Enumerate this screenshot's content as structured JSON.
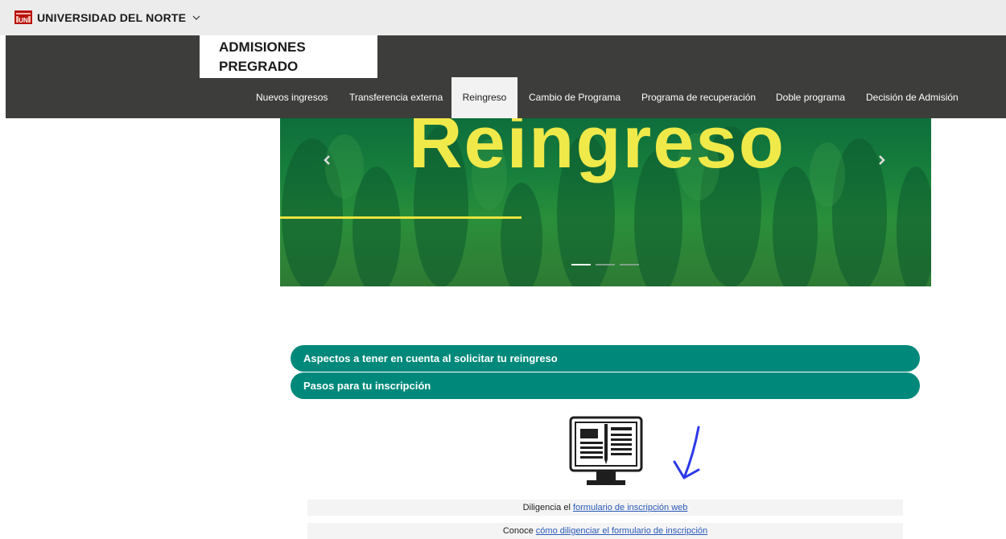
{
  "header": {
    "university": "UNIVERSIDAD DEL NORTE",
    "logo_text": "UN",
    "section_title_line1": "ADMISIONES",
    "section_title_line2": "PREGRADO"
  },
  "nav": {
    "items": [
      {
        "label": "Nuevos ingresos"
      },
      {
        "label": "Transferencia externa"
      },
      {
        "label": "Reingreso"
      },
      {
        "label": "Cambio de Programa"
      },
      {
        "label": "Programa de recuperación"
      },
      {
        "label": "Doble programa"
      },
      {
        "label": "Decisión de Admisión"
      }
    ],
    "active_index": 2
  },
  "hero": {
    "title": "Reingreso",
    "slides_count": 3,
    "active_slide": 0,
    "prev_icon": "chevron-left-icon",
    "next_icon": "chevron-right-icon"
  },
  "accordion": {
    "items": [
      {
        "label": "Aspectos a tener en cuenta al solicitar tu reingreso"
      },
      {
        "label": "Pasos para tu inscripción"
      }
    ]
  },
  "steps": {
    "row1": {
      "prefix": "Diligencia el ",
      "link": "formulario de inscripción web"
    },
    "row2": {
      "prefix": "Conoce ",
      "link": "cómo diligenciar el formulario de inscripción"
    }
  },
  "icons": {
    "monitor": "monitor-form-icon",
    "annotation": "blue-arrow-annotation"
  },
  "colors": {
    "nav_bg": "#3d3d3c",
    "accordion_bg": "#00897b",
    "hero_text": "#f0e94a",
    "link": "#2a5ab8",
    "annotation": "#2b39e8"
  }
}
